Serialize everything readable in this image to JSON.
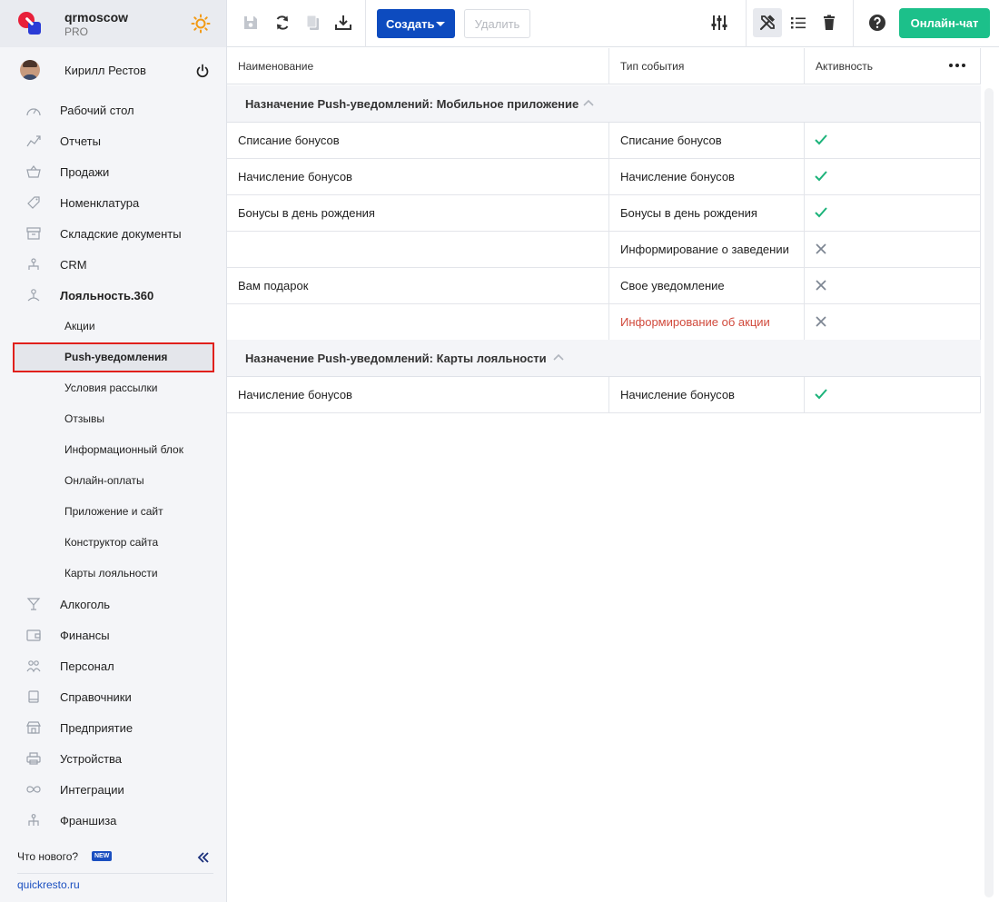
{
  "brand": {
    "name": "qrmoscow",
    "plan": "PRO"
  },
  "user": {
    "name": "Кирилл Рестов"
  },
  "nav": {
    "items": [
      {
        "label": "Рабочий стол",
        "icon": "dashboard-icon"
      },
      {
        "label": "Отчеты",
        "icon": "reports-icon"
      },
      {
        "label": "Продажи",
        "icon": "basket-icon"
      },
      {
        "label": "Номенклатура",
        "icon": "tag-icon"
      },
      {
        "label": "Складские документы",
        "icon": "archive-icon"
      },
      {
        "label": "CRM",
        "icon": "crm-icon"
      },
      {
        "label": "Лояльность.360",
        "icon": "loyalty-icon"
      }
    ],
    "sub": [
      {
        "label": "Акции"
      },
      {
        "label": "Push-уведомления"
      },
      {
        "label": "Условия рассылки"
      },
      {
        "label": "Отзывы"
      },
      {
        "label": "Информационный блок"
      },
      {
        "label": "Онлайн-оплаты"
      },
      {
        "label": "Приложение и сайт"
      },
      {
        "label": "Конструктор сайта"
      },
      {
        "label": "Карты лояльности"
      }
    ],
    "items2": [
      {
        "label": "Алкоголь",
        "icon": "glass-icon"
      },
      {
        "label": "Финансы",
        "icon": "wallet-icon"
      },
      {
        "label": "Персонал",
        "icon": "staff-icon"
      },
      {
        "label": "Справочники",
        "icon": "book-icon"
      },
      {
        "label": "Предприятие",
        "icon": "store-icon"
      },
      {
        "label": "Устройства",
        "icon": "printer-icon"
      },
      {
        "label": "Интеграции",
        "icon": "infinity-icon"
      },
      {
        "label": "Франшиза",
        "icon": "franchise-icon"
      }
    ]
  },
  "footer": {
    "whats_new": "Что нового?",
    "new_badge": "NEW",
    "site": "quickresto.ru"
  },
  "toolbar": {
    "create_label": "Создать",
    "delete_label": "Удалить",
    "chat_label": "Онлайн-чат"
  },
  "table": {
    "headers": {
      "name": "Наименование",
      "type": "Тип события",
      "active": "Активность"
    },
    "groups": [
      {
        "title": "Назначение Push-уведомлений: Мобильное приложение",
        "rows": [
          {
            "name": "Списание бонусов",
            "type": "Списание бонусов",
            "active": true
          },
          {
            "name": "Начисление бонусов",
            "type": "Начисление бонусов",
            "active": true
          },
          {
            "name": "Бонусы в день рождения",
            "type": "Бонусы в день рождения",
            "active": true
          },
          {
            "name": "",
            "type": "Информирование о заведении",
            "active": false
          },
          {
            "name": "Вам подарок",
            "type": "Свое уведомление",
            "active": false
          },
          {
            "name": "",
            "type": "Информирование об акции",
            "active": false,
            "type_color": "#d14a3c"
          }
        ]
      },
      {
        "title": "Назначение Push-уведомлений: Карты лояльности",
        "rows": [
          {
            "name": "Начисление бонусов",
            "type": "Начисление бонусов",
            "active": true
          }
        ]
      }
    ]
  },
  "colors": {
    "accent": "#0d4bbf",
    "chat": "#1cc08a",
    "check": "#1cb37a",
    "cross": "#7c8592",
    "highlight": "#e0201c"
  }
}
